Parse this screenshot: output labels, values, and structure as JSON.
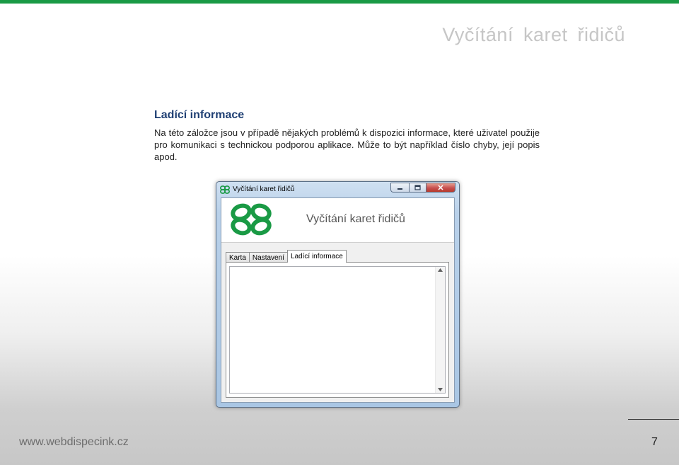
{
  "page": {
    "title": "Vyčítání karet řidičů",
    "section_heading": "Ladící informace",
    "body_text": "Na této záložce jsou v případě nějakých problémů k dispozici informace, které uživatel použije pro komunikaci s technickou podporou aplikace. Může to být například číslo chyby, její popis apod.",
    "accent_color": "#1a9a45"
  },
  "window": {
    "title": "Vyčítání karet řidičů",
    "banner_title": "Vyčítání karet řidičů",
    "controls": {
      "close_glyph": "✕"
    },
    "tabs": [
      {
        "label": "Karta",
        "active": false
      },
      {
        "label": "Nastavení",
        "active": false
      },
      {
        "label": "Ladící informace",
        "active": true
      }
    ]
  },
  "footer": {
    "url": "www.webdispecink.cz",
    "page_number": "7"
  }
}
